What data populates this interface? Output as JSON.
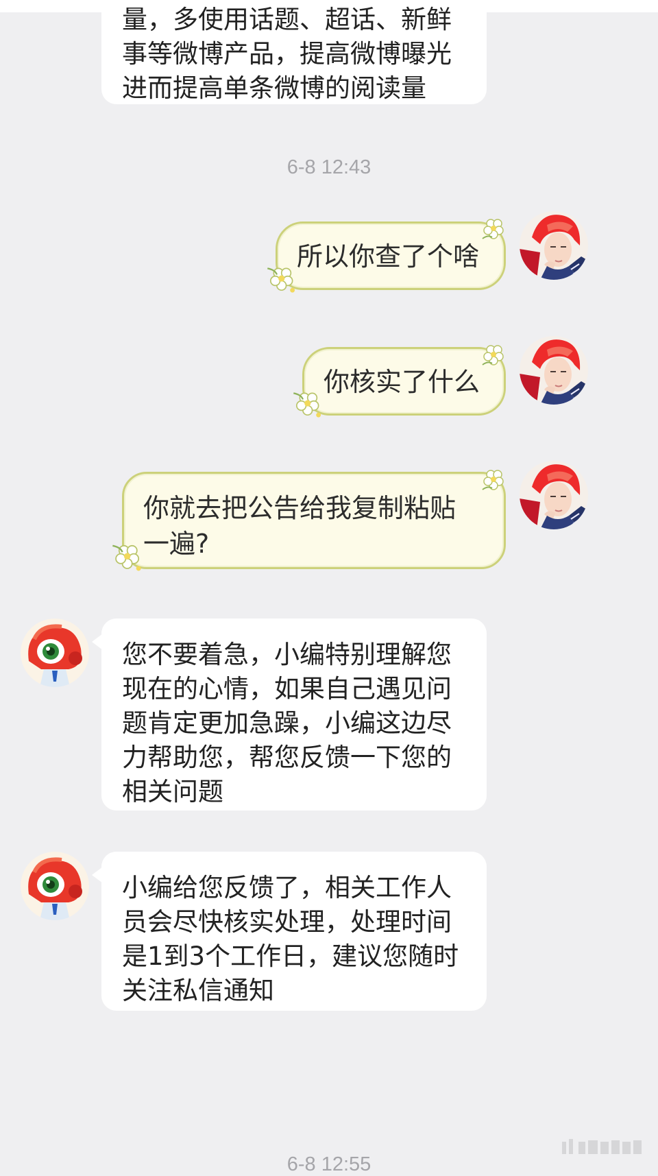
{
  "messages": {
    "m1_lines": [
      "量，多使用话题、超话、新鲜",
      "事等微博产品，提高微博曝光",
      "进而提高单条微博的阅读量"
    ],
    "ts1": "6-8 12:43",
    "m2": "所以你查了个啥",
    "m3": "你核实了什么",
    "m4_lines": [
      "你就去把公告给我复制粘贴",
      "一遍?"
    ],
    "m5_lines": [
      "您不要着急，小编特别理解您",
      "现在的心情，如果自己遇见问",
      "题肯定更加急躁，小编这边尽",
      "力帮助您，帮您反馈一下您的",
      "相关问题"
    ],
    "m6_lines": [
      "小编给您反馈了，相关工作人",
      "员会尽快核实处理，处理时间",
      "是1到3个工作日，建议您随时",
      "关注私信通知"
    ],
    "ts2": "6-8 12:55"
  },
  "colors": {
    "background": "#efeff1",
    "bot_bubble": "#ffffff",
    "user_bubble": "#fdfbe8",
    "user_bubble_border": "#ccd17a",
    "timestamp": "#a5a5a9"
  },
  "icons": {
    "user_avatar": "avatar-red-hair-portrait",
    "bot_avatar": "weibo-eye-mascot",
    "decoration": "flower-cluster"
  }
}
